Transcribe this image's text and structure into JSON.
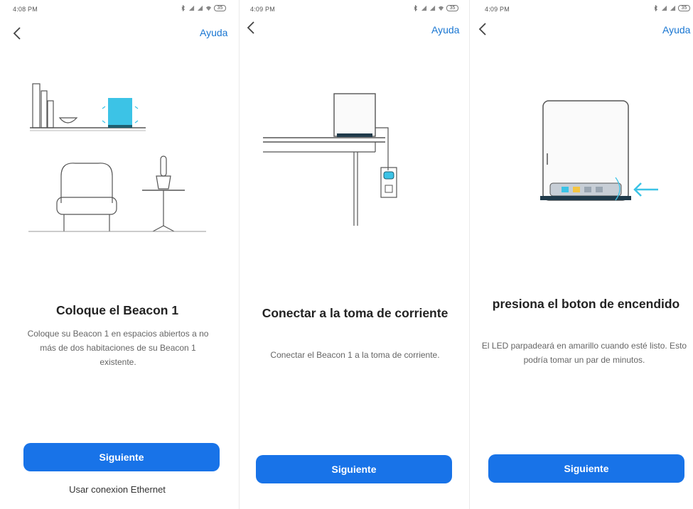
{
  "screens": [
    {
      "status_time": "4:08 PM",
      "help_label": "Ayuda",
      "title": "Coloque el Beacon 1",
      "description": "Coloque su Beacon 1 en espacios abiertos a no más de dos habitaciones de su Beacon 1 existente.",
      "next_button": "Siguiente",
      "secondary_link": "Usar conexion Ethernet"
    },
    {
      "status_time": "4:09 PM",
      "help_label": "Ayuda",
      "title": "Conectar a la toma de corriente",
      "description": "Conectar el Beacon 1 a la toma de corriente.",
      "next_button": "Siguiente"
    },
    {
      "status_time": "4:09 PM",
      "help_label": "Ayuda",
      "title": "presiona el boton de encendido",
      "description": "El LED parpadeará en amarillo cuando esté listo. Esto podría tomar un par de minutos.",
      "next_button": "Siguiente"
    }
  ],
  "battery_label": "35",
  "icons": {
    "back": "chevron-left-icon",
    "signal": "cellular-signal-icon",
    "wifi": "wifi-icon",
    "battery": "battery-icon",
    "bluetooth": "bluetooth-icon",
    "notification": "notification-icon",
    "arrow": "arrow-left-icon"
  },
  "colors": {
    "primary": "#1873e8",
    "link": "#1976d2",
    "device_accent": "#3cc3e6",
    "led_yellow": "#f4c542"
  }
}
